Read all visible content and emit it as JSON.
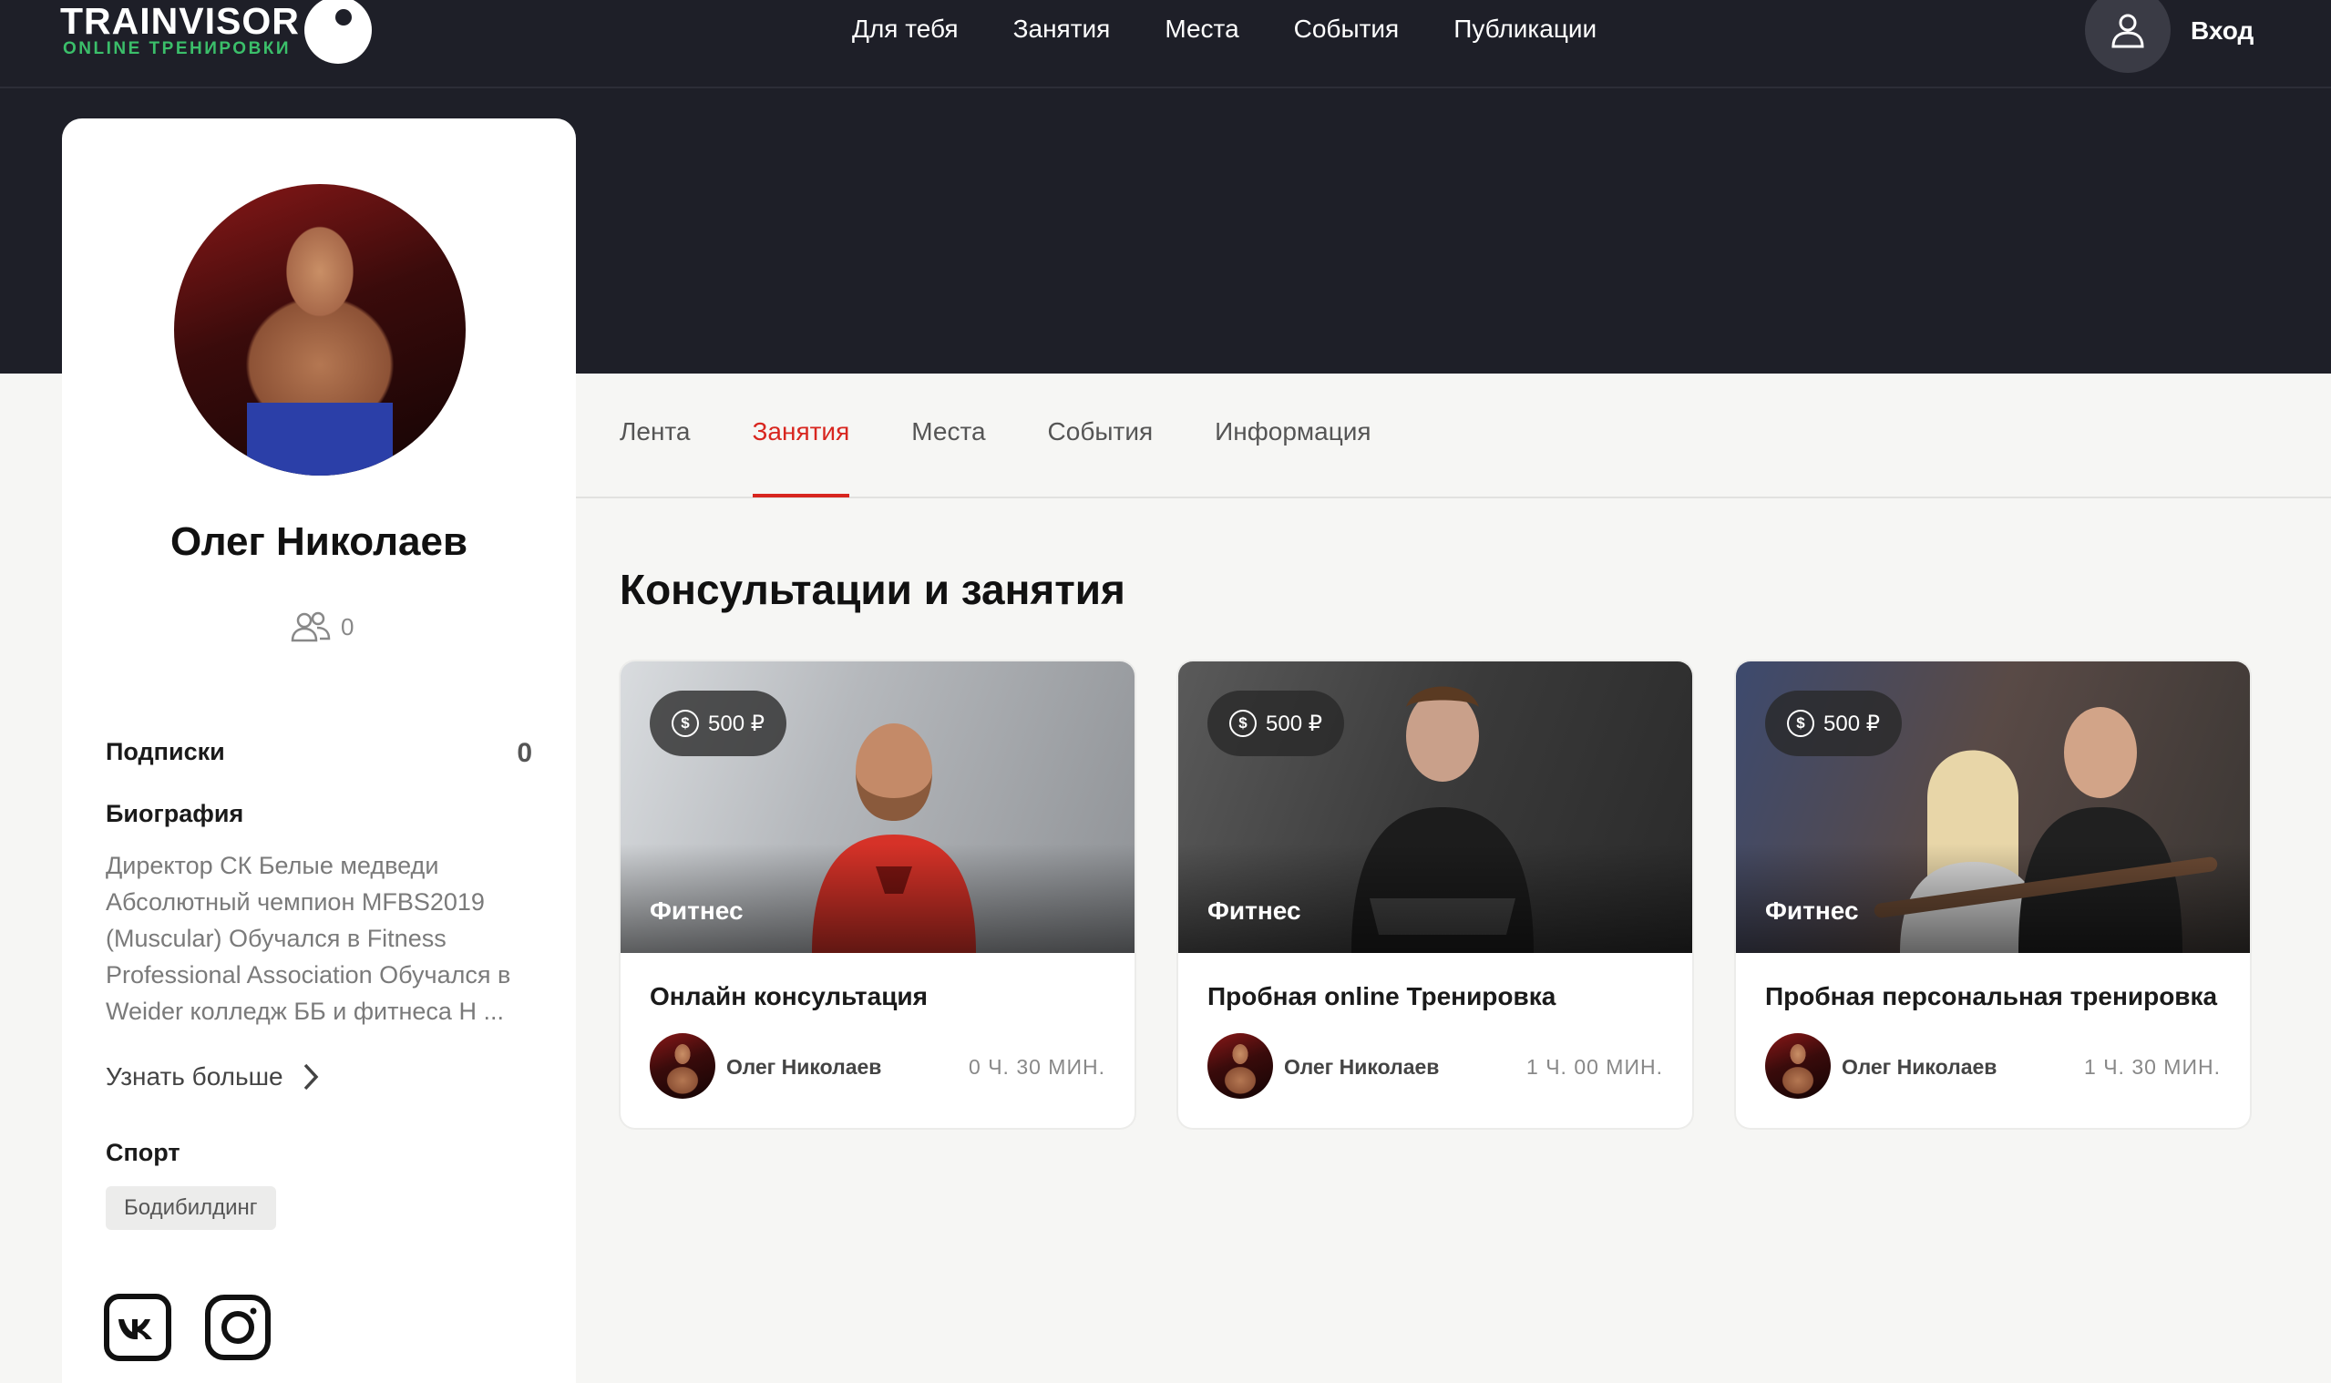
{
  "header": {
    "logo_title": "TRAINVISOR",
    "logo_subtitle": "ONLINE ТРЕНИРОВКИ",
    "nav": [
      "Для тебя",
      "Занятия",
      "Места",
      "События",
      "Публикации"
    ],
    "login_label": "Вход",
    "user_icon": "user-icon"
  },
  "tabs": [
    {
      "label": "Лента",
      "active": false
    },
    {
      "label": "Занятия",
      "active": true
    },
    {
      "label": "Места",
      "active": false
    },
    {
      "label": "События",
      "active": false
    },
    {
      "label": "Информация",
      "active": false
    }
  ],
  "profile": {
    "name": "Олег Николаев",
    "followers_count": "0",
    "subscriptions_label": "Подписки",
    "subscriptions_count": "0",
    "bio_label": "Биография",
    "bio": "Директор СК Белые медведи Абсолютный чемпион MFBS2019 (Muscular) Обучался в Fitness Professional Association Обучался в Weider колледж ББ и фитнеса Н ...",
    "more_label": "Узнать больше",
    "sport_label": "Спорт",
    "sport_tag": "Бодибилдинг",
    "social": [
      "vk-icon",
      "instagram-icon"
    ]
  },
  "content": {
    "section_title": "Консультации и занятия",
    "cards": [
      {
        "price": "500 ₽",
        "category": "Фитнес",
        "title": "Онлайн консультация",
        "trainer": "Олег Николаев",
        "duration": "0 Ч. 30 МИН."
      },
      {
        "price": "500 ₽",
        "category": "Фитнес",
        "title": "Пробная online Тренировка",
        "trainer": "Олег Николаев",
        "duration": "1 Ч. 00 МИН."
      },
      {
        "price": "500 ₽",
        "category": "Фитнес",
        "title": "Пробная персональная тренировка",
        "trainer": "Олег Николаев",
        "duration": "1 Ч. 30 МИН."
      }
    ]
  },
  "colors": {
    "header_bg": "#1e1f28",
    "accent_red": "#d8261f",
    "logo_green": "#3bbf6a",
    "page_bg": "#f6f6f4"
  }
}
